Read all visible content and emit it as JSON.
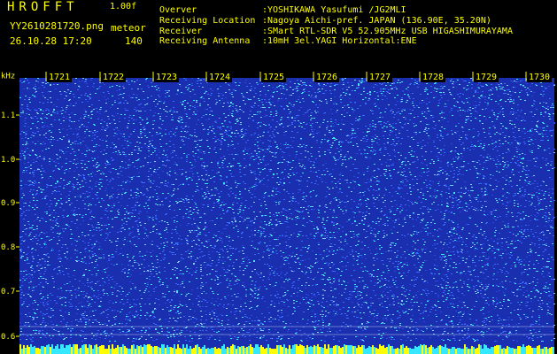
{
  "header": {
    "app_title": "HROFFT",
    "version": "1.00f",
    "filename": "YY2610281720.png",
    "mode": "meteor",
    "timestamp": "26.10.28 17:20",
    "count": "140",
    "info": [
      {
        "label": "Overver",
        "value": ":YOSHIKAWA Yasufumi /JG2MLI"
      },
      {
        "label": "Receiving Location",
        "value": ":Nagoya Aichi-pref. JAPAN (136.90E, 35.20N)"
      },
      {
        "label": "Receiver",
        "value": ":SMart RTL-SDR V5 52.905MHz USB HIGASHIMURAYAMA"
      },
      {
        "label": "Receiving Antenna",
        "value": ":10mH 3el.YAGI Horizontal:ENE"
      }
    ]
  },
  "spectrogram": {
    "y_unit": "kHz",
    "y_ticks": [
      "1.1",
      "1.0",
      "0.9",
      "0.8",
      "0.7",
      "0.6"
    ],
    "time_labels": [
      "1721",
      "1722",
      "1723",
      "1724",
      "1725",
      "1726",
      "1727",
      "1728",
      "1729",
      "1730"
    ],
    "colors": {
      "background": "#1a2fb0",
      "noise_low": "#3b6cff",
      "noise_high": "#36e8ff",
      "text": "#ffff00",
      "line": "#ffffff"
    }
  }
}
